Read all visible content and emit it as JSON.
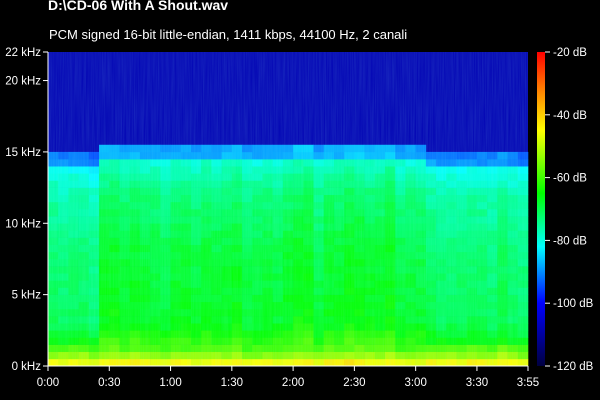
{
  "chart_data": {
    "type": "heatmap",
    "title": "D:\\CD-06 With A Shout.wav",
    "subtitle": "PCM signed 16-bit little-endian, 1411 kbps, 44100 Hz, 2 canali",
    "y_axis": {
      "ticks": [
        {
          "value": 0,
          "label": "0 kHz"
        },
        {
          "value": 5,
          "label": "5 kHz"
        },
        {
          "value": 10,
          "label": "10 kHz"
        },
        {
          "value": 15,
          "label": "15 kHz"
        },
        {
          "value": 20,
          "label": "20 kHz"
        },
        {
          "value": 22,
          "label": "22 kHz"
        }
      ],
      "range": [
        0,
        22
      ]
    },
    "x_axis": {
      "ticks": [
        {
          "value": 0,
          "label": "0:00"
        },
        {
          "value": 30,
          "label": "0:30"
        },
        {
          "value": 60,
          "label": "1:00"
        },
        {
          "value": 90,
          "label": "1:30"
        },
        {
          "value": 120,
          "label": "2:00"
        },
        {
          "value": 150,
          "label": "2:30"
        },
        {
          "value": 180,
          "label": "3:00"
        },
        {
          "value": 210,
          "label": "3:30"
        },
        {
          "value": 235,
          "label": "3:55"
        }
      ],
      "range": [
        0,
        235
      ]
    },
    "colorbar": {
      "range": [
        -120,
        -20
      ],
      "ticks": [
        {
          "value": -20,
          "label": "-20 dB"
        },
        {
          "value": -40,
          "label": "-40 dB"
        },
        {
          "value": -60,
          "label": "-60 dB"
        },
        {
          "value": -80,
          "label": "-80 dB"
        },
        {
          "value": -100,
          "label": "-100 dB"
        },
        {
          "value": -120,
          "label": "-120 dB"
        }
      ],
      "colors": [
        "#ff0000",
        "#ff8000",
        "#ffff00",
        "#00ff00",
        "#00ffff",
        "#0000ff",
        "#000040"
      ]
    },
    "levels": {
      "background_above_cutoff_db": -108,
      "cutoff_khz": 15.5,
      "cutoff_khz_intro_outro": 15,
      "body_db": [
        {
          "khz": 0.3,
          "db": -45
        },
        {
          "khz": 1,
          "db": -58
        },
        {
          "khz": 3,
          "db": -66
        },
        {
          "khz": 8,
          "db": -68
        },
        {
          "khz": 12,
          "db": -72
        },
        {
          "khz": 15,
          "db": -80
        }
      ],
      "quiet_sections": [
        {
          "start": 0,
          "end": 22
        },
        {
          "start": 185,
          "end": 235
        }
      ]
    }
  }
}
